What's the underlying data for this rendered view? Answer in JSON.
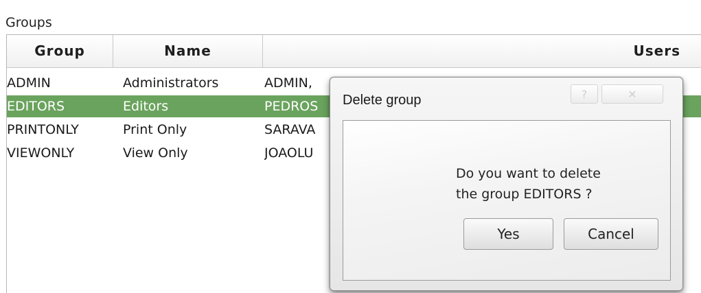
{
  "panel": {
    "title": "Groups"
  },
  "table": {
    "columns": [
      "Group",
      "Name",
      "Users"
    ],
    "rows": [
      {
        "group": "ADMIN",
        "name": "Administrators",
        "users": "ADMIN,"
      },
      {
        "group": "EDITORS",
        "name": "Editors",
        "users": "PEDROS"
      },
      {
        "group": "PRINTONLY",
        "name": "Print Only",
        "users": "SARAVA"
      },
      {
        "group": "VIEWONLY",
        "name": "View Only",
        "users": "JOAOLU"
      }
    ],
    "selected_row_index": 1,
    "selected_color": "#6aa35d"
  },
  "dialog": {
    "title": "Delete group",
    "help_icon": "help-question-icon",
    "help_glyph": "?",
    "close_icon": "close-icon",
    "close_glyph": "✕",
    "message_line1": "Do you want to delete",
    "message_line2": "the group EDITORS ?",
    "yes_label": "Yes",
    "cancel_label": "Cancel"
  }
}
